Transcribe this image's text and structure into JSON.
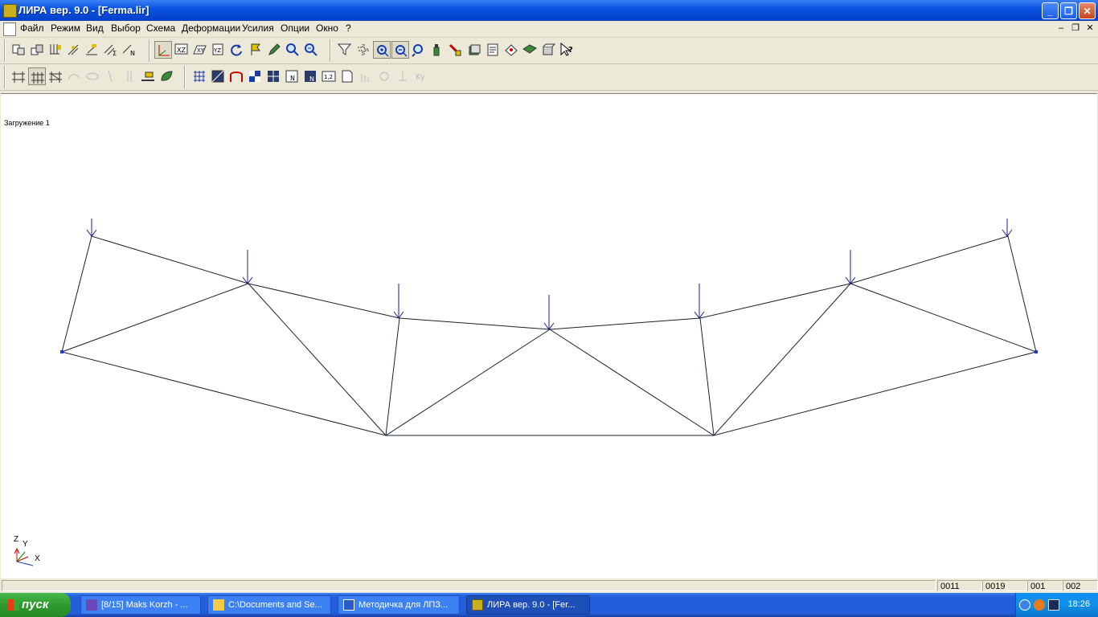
{
  "window": {
    "title": "ЛИРА  вер. 9.0 - [Ferma.lir]",
    "minimize": "_",
    "maximize": "❐",
    "close": "✕"
  },
  "menu": [
    "Файл",
    "Режим",
    "Вид",
    "Выбор",
    "Схема",
    "Деформации",
    "Усилия",
    "Опции",
    "Окно",
    "?"
  ],
  "mdi_controls": {
    "minimize": "–",
    "restore": "❐",
    "close": "✕"
  },
  "canvas": {
    "load_case_label": "Загружение  1",
    "axes": {
      "z": "Z",
      "y": "Y",
      "x": "X"
    }
  },
  "status": {
    "cells": [
      "0011",
      "0019",
      "001",
      "002"
    ]
  },
  "taskbar": {
    "start": "пуск",
    "tasks": [
      {
        "label": "[8/15] Maks Korzh - ...",
        "icon": "media-player-icon"
      },
      {
        "label": "C:\\Documents and Se...",
        "icon": "folder-icon"
      },
      {
        "label": "Методичка для ЛПЗ...",
        "icon": "word-icon"
      },
      {
        "label": "ЛИРА  вер. 9.0 - [Fer...",
        "icon": "lira-icon"
      }
    ],
    "clock": "18:26"
  },
  "colors": {
    "truss": "#1a2030",
    "load_arrow": "#1d1d8a",
    "support_node": "#2838c8"
  }
}
